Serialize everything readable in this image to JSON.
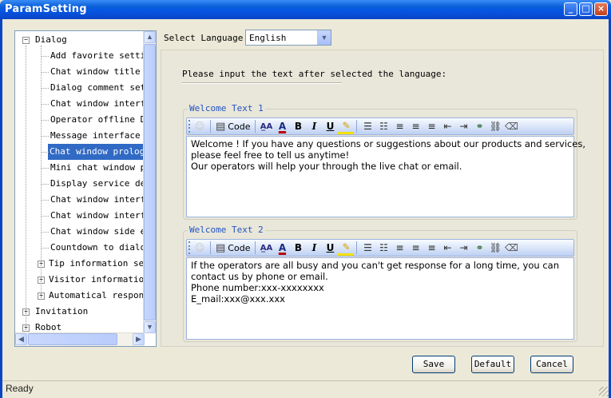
{
  "window": {
    "title": "ParamSetting",
    "minimize": "_",
    "maximize": "□",
    "close": "×"
  },
  "tree": {
    "items": [
      {
        "label": "Dialog",
        "level": 0,
        "expander": "−"
      },
      {
        "label": "Add favorite setting",
        "level": 1
      },
      {
        "label": "Chat window title se",
        "level": 1
      },
      {
        "label": "Dialog comment setti",
        "level": 1
      },
      {
        "label": "Chat window interfac",
        "level": 1
      },
      {
        "label": "Operator offline Dis",
        "level": 1
      },
      {
        "label": "Message interface se",
        "level": 1
      },
      {
        "label": "Chat window prologue",
        "level": 1,
        "selected": true
      },
      {
        "label": "Mini chat window pro",
        "level": 1
      },
      {
        "label": "Display service depa",
        "level": 1
      },
      {
        "label": "Chat window interfac",
        "level": 1
      },
      {
        "label": "Chat window interfac",
        "level": 1
      },
      {
        "label": "Chat window side edg",
        "level": 1
      },
      {
        "label": "Countdown to dialog ",
        "level": 1
      },
      {
        "label": "Tip information sett",
        "level": 1,
        "expander": "+"
      },
      {
        "label": "Visitor information ",
        "level": 1,
        "expander": "+"
      },
      {
        "label": "Automatical response",
        "level": 1,
        "expander": "+"
      },
      {
        "label": "Invitation",
        "level": 0,
        "expander": "+"
      },
      {
        "label": "Robot",
        "level": 0,
        "expander": "+"
      }
    ]
  },
  "language": {
    "label": "Select Language",
    "selected": "English"
  },
  "instruction": "Please input the text after selected the language:",
  "toolbar": {
    "code_label": "Code"
  },
  "welcome1": {
    "title": "Welcome Text 1",
    "lines": [
      "Welcome ! If you have any questions or suggestions about our products and services,",
      "please feel free to tell us anytime!",
      "Our operators will help your through the live chat or email."
    ]
  },
  "welcome2": {
    "title": "Welcome Text 2",
    "lines": [
      "If the operators are all busy and you can't get response for a long time, you can",
      "contact us by phone or email.",
      "Phone number:xxx-xxxxxxxx",
      "E_mail:xxx@xxx.xxx"
    ]
  },
  "buttons": {
    "save": "Save",
    "default": "Default",
    "cancel": "Cancel"
  },
  "status": "Ready",
  "colors": {
    "titlebar": "#0554e2",
    "selection": "#316ac5",
    "group_title": "#2155c0"
  }
}
